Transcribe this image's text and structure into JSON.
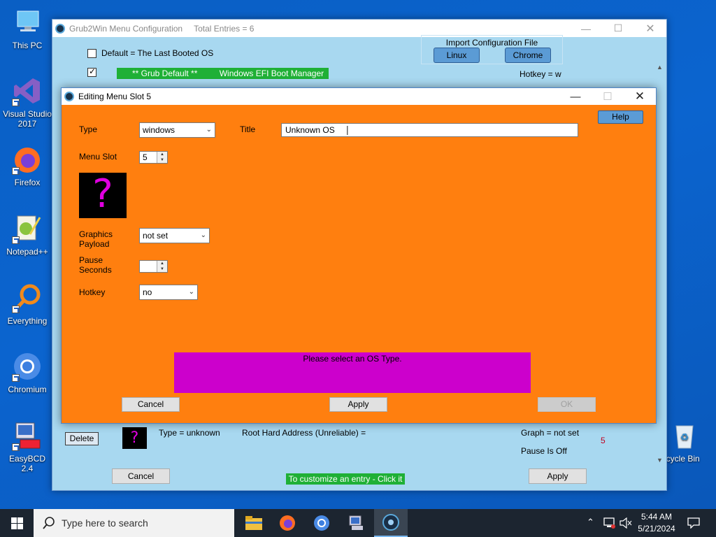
{
  "desktop": {
    "icons": [
      {
        "label": "This PC"
      },
      {
        "label": "Visual Studio 2017"
      },
      {
        "label": "Firefox"
      },
      {
        "label": "Notepad++"
      },
      {
        "label": "Everything"
      },
      {
        "label": "Chromium"
      },
      {
        "label": "EasyBCD 2.4"
      },
      {
        "label": "Recycle Bin"
      }
    ]
  },
  "main_window": {
    "title": "Grub2Win Menu Configuration",
    "entries_text": "Total Entries = 6",
    "default_option_label": "Default = The Last Booted OS",
    "import": {
      "label": "Import Configuration File",
      "linux_label": "Linux",
      "chrome_label": "Chrome"
    },
    "grub_default_label": "** Grub Default **",
    "grub_default_entry": "Windows EFI Boot Manager",
    "hotkey_text": "Hotkey = w",
    "entry5": {
      "delete_label": "Delete",
      "type_text": "Type = unknown",
      "root_text": "Root Hard Address (Unreliable) =",
      "graph_text": "Graph = not set",
      "pause_text": "Pause Is Off",
      "slot_number": "5"
    },
    "cancel_label": "Cancel",
    "customize_text": "To customize an entry - Click it",
    "apply_label": "Apply"
  },
  "dialog": {
    "title": "Editing Menu Slot 5",
    "help_label": "Help",
    "type_label": "Type",
    "type_value": "windows",
    "title_label": "Title",
    "title_value": "Unknown OS",
    "menu_slot_label": "Menu Slot",
    "menu_slot_value": "5",
    "graphics_label_1": "Graphics",
    "graphics_label_2": "Payload",
    "graphics_value": "not set",
    "pause_label_1": "Pause",
    "pause_label_2": "Seconds",
    "pause_value": "",
    "hotkey_label": "Hotkey",
    "hotkey_value": "no",
    "message": "Please select an OS Type.",
    "cancel_label": "Cancel",
    "apply_label": "Apply",
    "ok_label": "OK"
  },
  "taskbar": {
    "search_placeholder": "Type here to search",
    "time": "5:44 AM",
    "date": "5/21/2024"
  },
  "colors": {
    "dialog_bg": "#ff7f0f",
    "main_bg": "#a8d8f0",
    "message_bg": "#cc00cc",
    "green": "#1fb036",
    "help_blue": "#5b9bd5"
  }
}
